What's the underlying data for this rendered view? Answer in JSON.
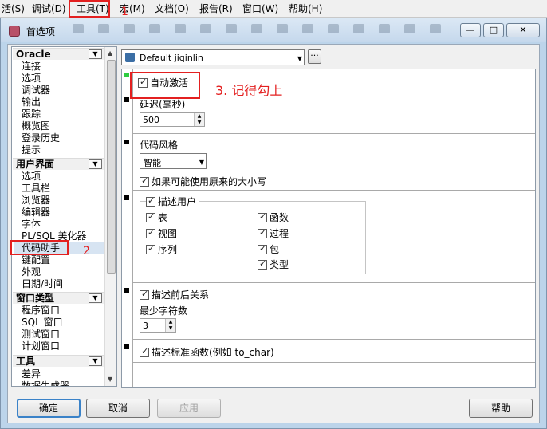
{
  "app_menu": [
    "活(S)",
    "调试(D)",
    "工具(T)",
    "宏(M)",
    "文档(O)",
    "报告(R)",
    "窗口(W)",
    "帮助(H)"
  ],
  "dialog": {
    "title": "首选项",
    "window_buttons": [
      "—",
      "□",
      "✕"
    ]
  },
  "profile": {
    "value": "Default jiqinlin",
    "more_label": "···"
  },
  "tree": {
    "sections": [
      {
        "label": "Oracle",
        "items": [
          "连接",
          "选项",
          "调试器",
          "输出",
          "跟踪",
          "概览图",
          "登录历史",
          "提示"
        ]
      },
      {
        "label": "用户界面",
        "items": [
          "选项",
          "工具栏",
          "浏览器",
          "编辑器",
          "字体",
          "PL/SQL 美化器",
          "代码助手",
          "键配置",
          "外观",
          "日期/时间"
        ]
      },
      {
        "label": "窗口类型",
        "items": [
          "程序窗口",
          "SQL 窗口",
          "测试窗口",
          "计划窗口"
        ]
      },
      {
        "label": "工具",
        "items": [
          "差异",
          "数据生成器"
        ]
      }
    ],
    "selected": "代码助手"
  },
  "settings": {
    "auto_activate": "自动激活",
    "delay_label": "延迟(毫秒)",
    "delay_value": "500",
    "code_style_label": "代码风格",
    "code_style_value": "智能",
    "keep_case": "如果可能使用原来的大小写",
    "describe_users": "描述用户",
    "object_types": [
      "表",
      "视图",
      "序列",
      "函数",
      "过程",
      "包",
      "类型"
    ],
    "describe_context": "描述前后关系",
    "min_chars_label": "最少字符数",
    "min_chars_value": "3",
    "describe_std": "描述标准函数(例如 to_char)"
  },
  "buttons": {
    "ok": "确定",
    "cancel": "取消",
    "apply": "应用",
    "help": "帮助"
  },
  "annotations": {
    "step1": "1",
    "step2": "2",
    "step3": "3. 记得勾上"
  },
  "colors": {
    "annotation_red": "#e32020",
    "dialog_frame": "#bcd4ea",
    "default_button": "#3a82c8"
  }
}
